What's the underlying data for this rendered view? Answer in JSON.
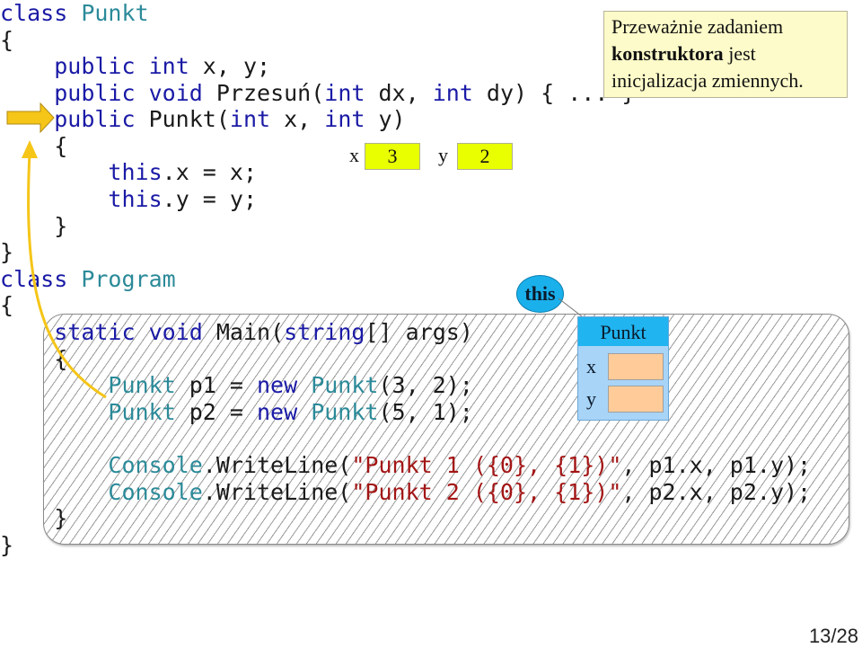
{
  "code": {
    "line1": {
      "kw": "class",
      "name": "Punkt"
    },
    "line2": "{",
    "line3": {
      "kw1": "public",
      "kw2": "int",
      "rest": " x, y;"
    },
    "line4": {
      "kw1": "public",
      "kw2": "void",
      "name": " Przesuń(",
      "kw3": "int",
      "mid": " dx, ",
      "kw4": "int",
      "rest": " dy) { ... }"
    },
    "line5": {
      "kw1": "public",
      "name": " Punkt(",
      "kw2": "int",
      "mid": " x, ",
      "kw3": "int",
      "rest": " y)"
    },
    "line6": "{",
    "line7": {
      "kw": "this",
      "rest": ".x = x;"
    },
    "line8": {
      "kw": "this",
      "rest": ".y = y;"
    },
    "line9": "}",
    "line10": "}",
    "line11": {
      "kw": "class",
      "name": "Program"
    },
    "line12": "{",
    "line13": {
      "kw1": "static",
      "kw2": "void",
      "name": " Main(",
      "kw3": "string",
      "rest": "[] args)"
    },
    "line14": "{",
    "line15": {
      "type1": "Punkt",
      "mid1": " p1 = ",
      "kw": "new",
      "type2": " Punkt",
      "rest": "(3, 2);"
    },
    "line16": {
      "type1": "Punkt",
      "mid1": " p2 = ",
      "kw": "new",
      "type2": " Punkt",
      "rest": "(5, 1);"
    },
    "line17": {
      "type": "Console",
      "mid": ".WriteLine(",
      "str": "\"Punkt 1 ({0}, {1})\"",
      "rest": ", p1.x, p1.y);"
    },
    "line18": {
      "type": "Console",
      "mid": ".WriteLine(",
      "str": "\"Punkt 2 ({0}, {1})\"",
      "rest": ", p2.x, p2.y);"
    },
    "line19": "}",
    "line20": "}"
  },
  "tooltip": {
    "line1": "Przeważnie zadaniem",
    "bold": "konstruktora",
    "line2_rest": " jest",
    "line3": "inicjalizacja zmiennych."
  },
  "params": {
    "x_label": "x",
    "x_value": "3",
    "y_label": "y",
    "y_value": "2"
  },
  "this_label": "this",
  "object": {
    "class_name": "Punkt",
    "field_x": "x",
    "field_y": "y"
  },
  "page_number": "13/28",
  "colors": {
    "keyword": "#1a1aa6",
    "type": "#2b8a99",
    "string": "#a31515",
    "arrow": "#f5c518",
    "param_box": "#e9ff00",
    "object_header": "#20b4f0",
    "object_body": "#a8d4f7",
    "object_field": "#ffcc99",
    "tooltip_bg": "#fdfbc9"
  }
}
